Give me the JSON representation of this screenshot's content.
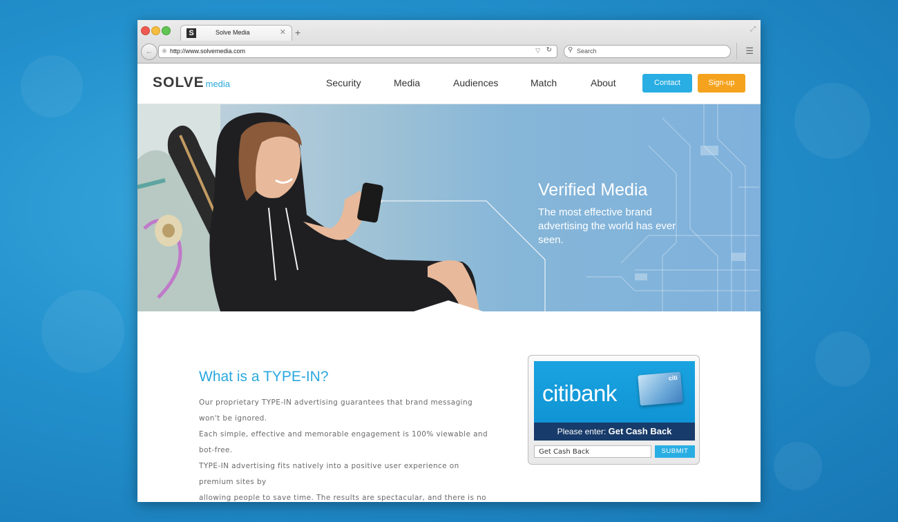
{
  "browser": {
    "tab_title": "Solve Media",
    "tab_favicon": "S",
    "url": "http://www.solvemedia.com",
    "search_placeholder": "Search"
  },
  "site": {
    "logo_main": "SOLVE",
    "logo_sub": "media",
    "nav": [
      "Security",
      "Media",
      "Audiences",
      "Match",
      "About"
    ],
    "contact_label": "Contact",
    "signup_label": "Sign-up",
    "brand_color": "#29aee3",
    "accent_color": "#f5a31e"
  },
  "hero": {
    "title": "Verified Media",
    "subtitle": "The most effective brand advertising the world has ever seen."
  },
  "info": {
    "title": "What is a TYPE-IN?",
    "lines": [
      "Our proprietary TYPE-IN advertising guarantees that brand messaging won't be ignored.",
      "Each simple, effective and memorable engagement is 100% viewable and bot-free.",
      "TYPE-IN advertising fits natively into a positive user experience on premium sites by",
      "allowing people to save time. The results are spectacular, and there is no media waste."
    ]
  },
  "typein": {
    "ad_brand": "citibank",
    "card_brand": "citi",
    "prompt_prefix": "Please enter:",
    "prompt_phrase": "Get Cash Back",
    "input_value": "Get Cash Back",
    "submit_label": "SUBMIT"
  }
}
